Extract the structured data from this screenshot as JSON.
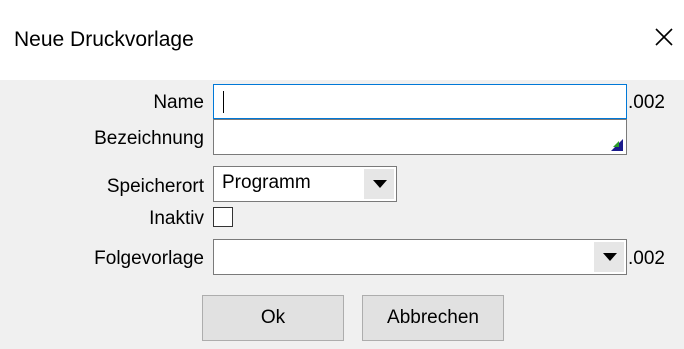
{
  "window": {
    "title": "Neue Druckvorlage",
    "close_icon": "close-icon"
  },
  "form": {
    "name": {
      "label": "Name",
      "value": "",
      "suffix": ".002"
    },
    "bezeichnung": {
      "label": "Bezeichnung",
      "value": ""
    },
    "speicherort": {
      "label": "Speicherort",
      "value": "Programm"
    },
    "inaktiv": {
      "label": "Inaktiv",
      "checked": false
    },
    "folgevorlage": {
      "label": "Folgevorlage",
      "value": "",
      "suffix": ".002"
    }
  },
  "buttons": {
    "ok": "Ok",
    "cancel": "Abbrechen"
  }
}
